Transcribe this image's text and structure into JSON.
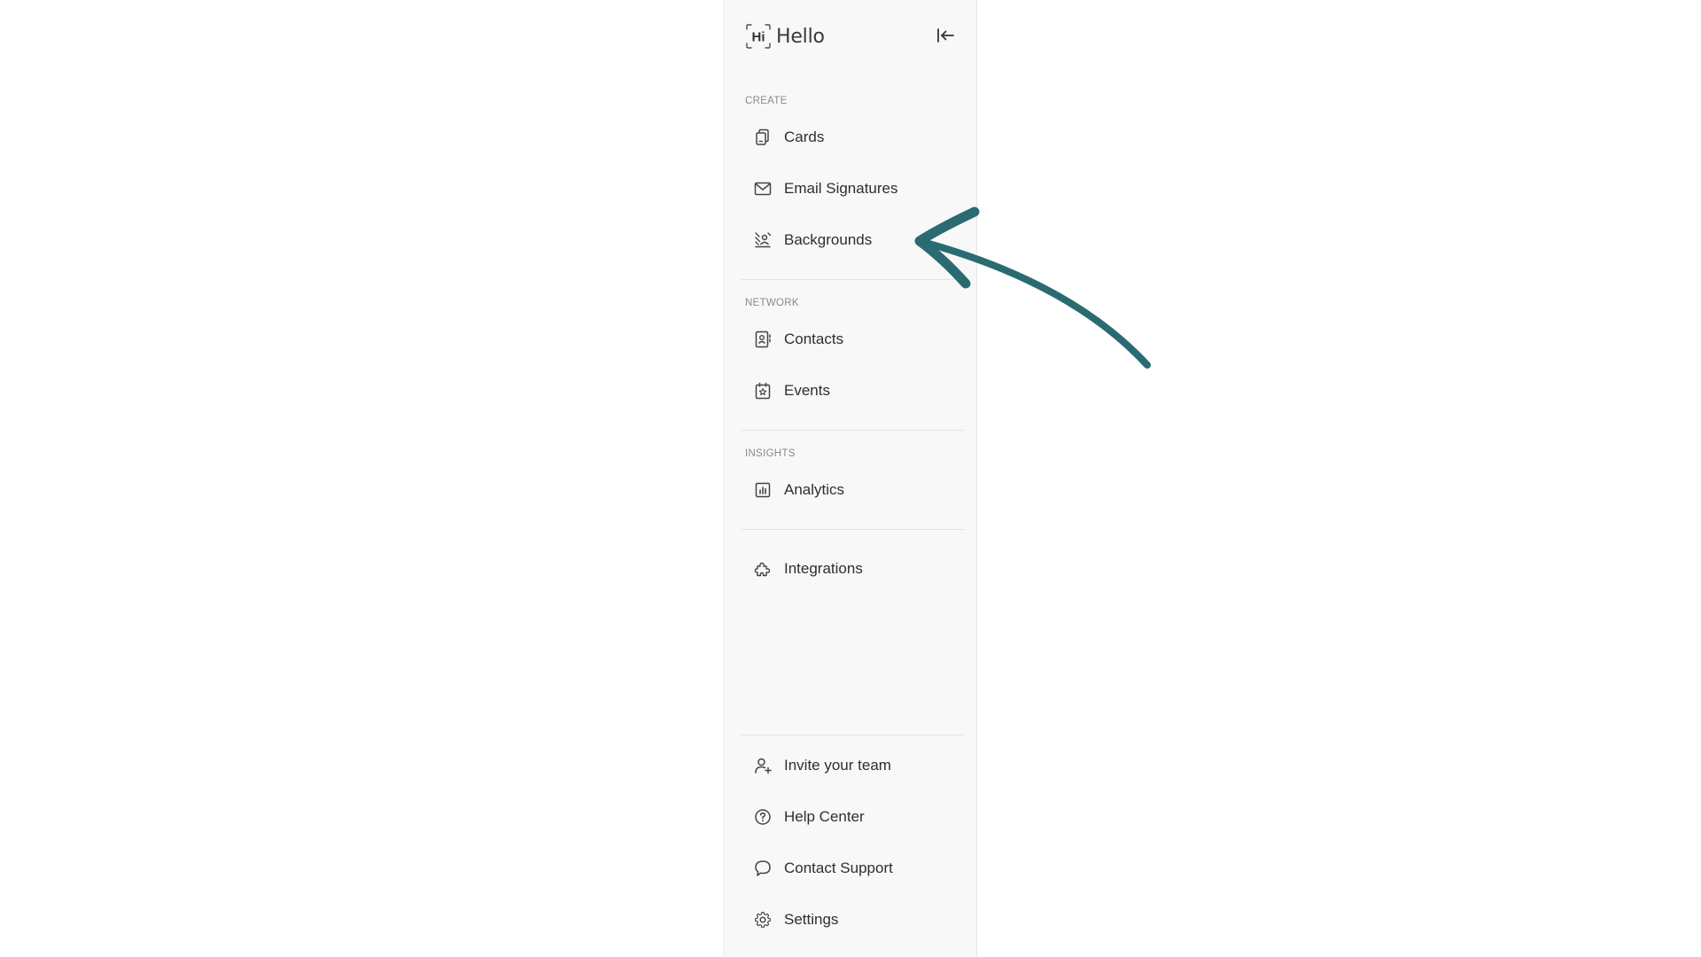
{
  "app": {
    "logo_mark_text": "Hi",
    "logo_text": "Hello"
  },
  "header": {
    "collapse_icon": "collapse-sidebar-icon"
  },
  "sections": {
    "create": {
      "label": "CREATE",
      "items": [
        {
          "label": "Cards",
          "icon": "cards-icon"
        },
        {
          "label": "Email Signatures",
          "icon": "mail-icon"
        },
        {
          "label": "Backgrounds",
          "icon": "backgrounds-icon"
        }
      ]
    },
    "network": {
      "label": "NETWORK",
      "items": [
        {
          "label": "Contacts",
          "icon": "contacts-icon"
        },
        {
          "label": "Events",
          "icon": "calendar-star-icon"
        }
      ]
    },
    "insights": {
      "label": "INSIGHTS",
      "items": [
        {
          "label": "Analytics",
          "icon": "analytics-icon"
        }
      ]
    },
    "more": {
      "items": [
        {
          "label": "Integrations",
          "icon": "puzzle-icon"
        }
      ]
    },
    "bottom": {
      "items": [
        {
          "label": "Invite your team",
          "icon": "add-user-icon"
        },
        {
          "label": "Help Center",
          "icon": "help-circle-icon"
        },
        {
          "label": "Contact Support",
          "icon": "chat-bubble-icon"
        },
        {
          "label": "Settings",
          "icon": "gear-icon"
        }
      ]
    }
  },
  "colors": {
    "sidebar_bg": "#f8f8f8",
    "text": "#2e2e2e",
    "section_label": "#8a8a8a",
    "annotation_arrow": "#2a6b72"
  }
}
